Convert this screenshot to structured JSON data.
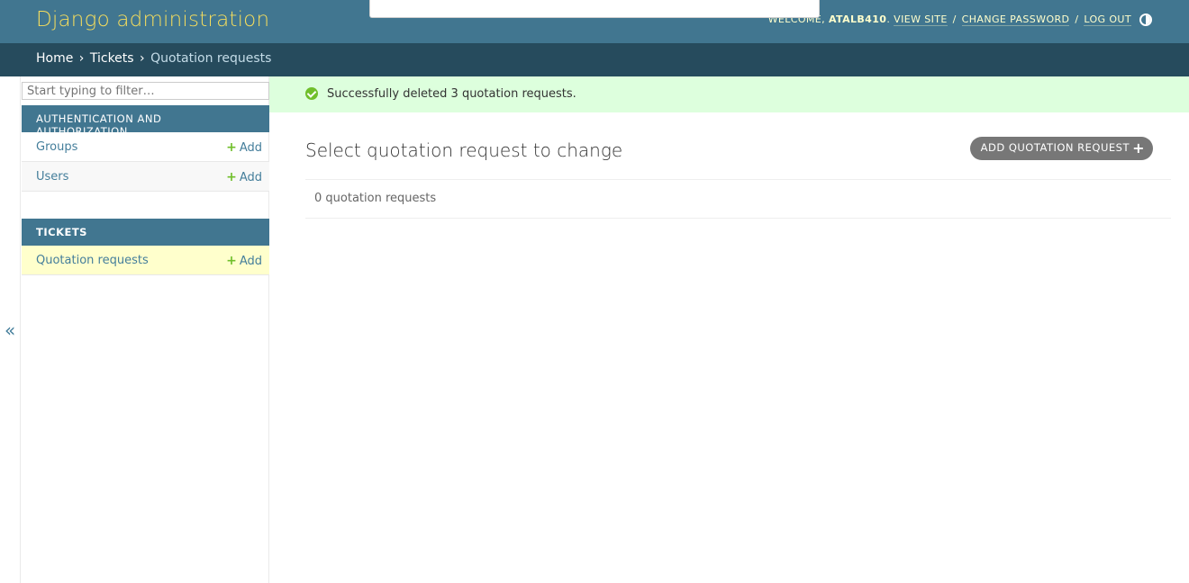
{
  "header": {
    "site_name": "Django administration",
    "welcome": "WELCOME,",
    "username": "ATALB410",
    "view_site": "VIEW SITE",
    "change_password": "CHANGE PASSWORD",
    "log_out": "LOG OUT",
    "theme_icon": "contrast-icon"
  },
  "breadcrumbs": {
    "home": "Home",
    "app": "Tickets",
    "current": "Quotation requests",
    "separator": "›"
  },
  "sidebar": {
    "filter_placeholder": "Start typing to filter…",
    "collapse_label": "«",
    "modules": [
      {
        "caption": "AUTHENTICATION AND AUTHORIZATION",
        "models": [
          {
            "name": "Groups",
            "add": "Add"
          },
          {
            "name": "Users",
            "add": "Add"
          }
        ]
      },
      {
        "caption": "TICKETS",
        "models": [
          {
            "name": "Quotation requests",
            "add": "Add"
          }
        ]
      }
    ]
  },
  "message": {
    "text": "Successfully deleted 3 quotation requests.",
    "level": "success"
  },
  "main": {
    "title": "Select quotation request to change",
    "add_button": "ADD QUOTATION REQUEST",
    "result_count": "0 quotation requests"
  },
  "colors": {
    "header_bg": "#417690",
    "breadcrumb_bg": "#264b5d",
    "brand_text": "#f5dd5d",
    "success_bg": "#ddffdd",
    "selected_row": "#ffffcc"
  }
}
